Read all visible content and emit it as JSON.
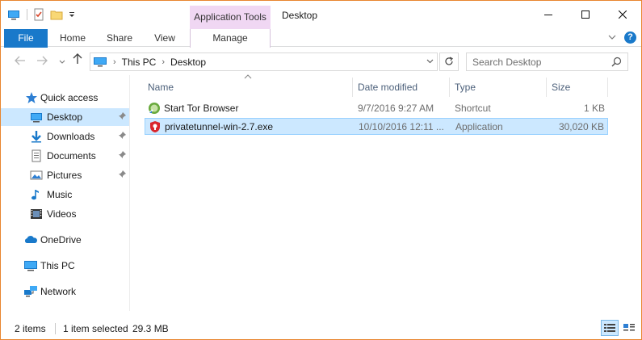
{
  "window": {
    "title": "Desktop",
    "contextual_tab_group": "Application Tools"
  },
  "ribbon": {
    "tabs": {
      "file": "File",
      "home": "Home",
      "share": "Share",
      "view": "View",
      "manage": "Manage"
    },
    "help": "?"
  },
  "address": {
    "crumbs": [
      "This PC",
      "Desktop"
    ],
    "search_placeholder": "Search Desktop"
  },
  "nav": {
    "quick_access": "Quick access",
    "items": [
      {
        "label": "Desktop",
        "icon": "desktop-icon",
        "pinned": true,
        "selected": true
      },
      {
        "label": "Downloads",
        "icon": "download-icon",
        "pinned": true
      },
      {
        "label": "Documents",
        "icon": "documents-icon",
        "pinned": true
      },
      {
        "label": "Pictures",
        "icon": "pictures-icon",
        "pinned": true
      },
      {
        "label": "Music",
        "icon": "music-icon",
        "pinned": false
      },
      {
        "label": "Videos",
        "icon": "videos-icon",
        "pinned": false
      }
    ],
    "onedrive": "OneDrive",
    "this_pc": "This PC",
    "network": "Network"
  },
  "filelist": {
    "columns": {
      "name": "Name",
      "date": "Date modified",
      "type": "Type",
      "size": "Size"
    },
    "sorted_by": "Name",
    "rows": [
      {
        "name": "Start Tor Browser",
        "date": "9/7/2016 9:27 AM",
        "type": "Shortcut",
        "size": "1 KB",
        "icon": "tor-browser-icon",
        "selected": false
      },
      {
        "name": "privatetunnel-win-2.7.exe",
        "date": "10/10/2016 12:11 ...",
        "type": "Application",
        "size": "30,020 KB",
        "icon": "privatetunnel-icon",
        "selected": true
      }
    ]
  },
  "status": {
    "item_count": "2 items",
    "selection": "1 item selected",
    "selection_size": "29.3 MB"
  },
  "colors": {
    "accent": "#1979ca",
    "selection": "#cce8ff",
    "window_border": "#e8862f",
    "contextual_tab": "#f0d7f3"
  }
}
